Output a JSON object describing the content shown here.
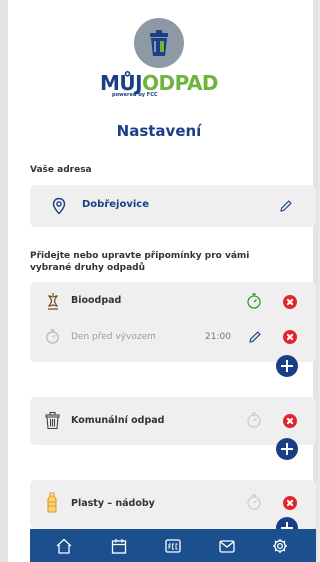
{
  "logo": {
    "part1": "MŮJ",
    "part2": "ODPAD",
    "sub": "powered by FCC"
  },
  "page_title": "Nastavení",
  "address_section": {
    "label": "Vaše adresa",
    "value": "Dobřejovice"
  },
  "waste_section": {
    "label_line1": "Přidejte nebo upravte připomínky pro vámi",
    "label_line2": "vybrané druhy odpadů",
    "items": [
      {
        "name": "Bioodpad",
        "reminder": {
          "label": "Den před vývozem",
          "time": "21:00"
        }
      },
      {
        "name": "Komunální odpad"
      },
      {
        "name": "Plasty – nádoby"
      }
    ]
  },
  "nav": {
    "items": [
      "home-icon",
      "calendar-icon",
      "fcc-icon",
      "mail-icon",
      "settings-icon"
    ]
  },
  "colors": {
    "brand_blue": "#1b3f86",
    "brand_green": "#6eb43f",
    "nav_bg": "#1b4f8e",
    "delete_red": "#e3262e",
    "timer_green": "#3d9b35"
  }
}
